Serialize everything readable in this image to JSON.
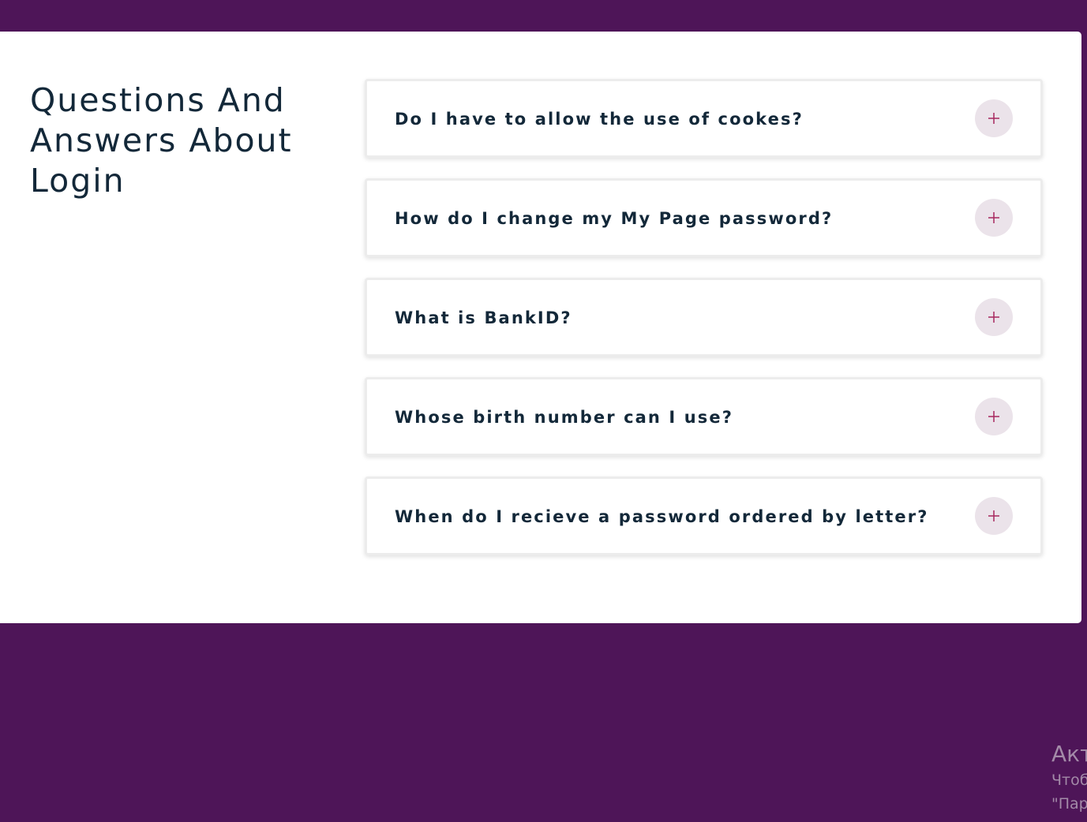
{
  "page": {
    "heading": "Questions And Answers About Login"
  },
  "faq": {
    "items": [
      {
        "question": "Do I have to allow the use of cookes?",
        "icon": "plus-icon"
      },
      {
        "question": "How do I change my My Page password?",
        "icon": "plus-icon"
      },
      {
        "question": "What is BankID?",
        "icon": "plus-icon"
      },
      {
        "question": "Whose birth number can I use?",
        "icon": "plus-icon"
      },
      {
        "question": "When do I recieve a password ordered by letter?",
        "icon": "plus-icon"
      }
    ]
  },
  "watermark": {
    "title": "Акт",
    "line1": "Чтоб",
    "line2": "\"Пар"
  },
  "colors": {
    "background": "#4e1558",
    "card": "#ffffff",
    "text": "#132839",
    "accent": "#a8285e",
    "button_bg": "#ebe3ea"
  }
}
